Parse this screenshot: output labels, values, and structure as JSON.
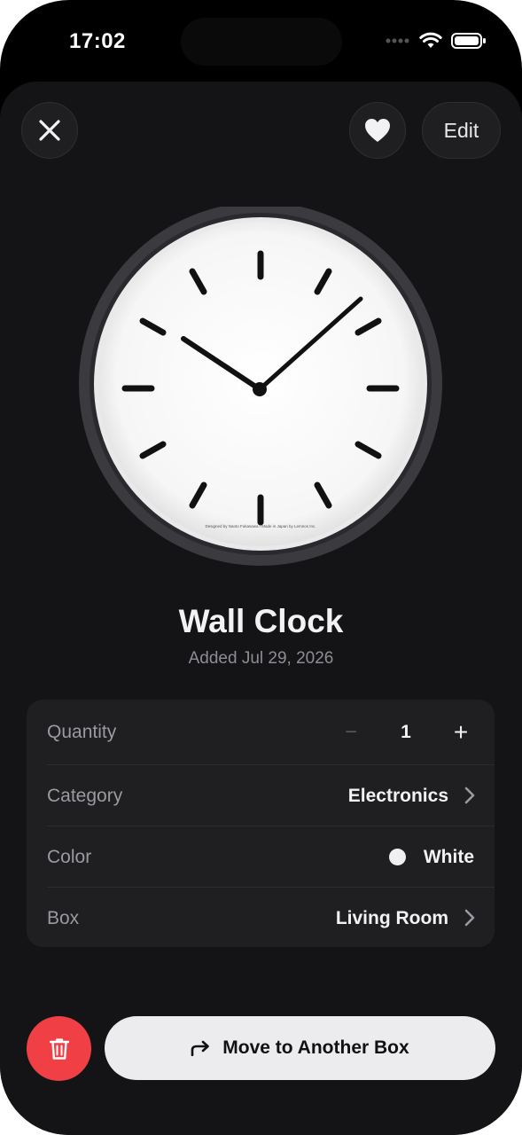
{
  "status_bar": {
    "time": "17:02"
  },
  "toolbar": {
    "close_icon": "close-icon",
    "favorite_icon": "heart-icon",
    "edit_label": "Edit"
  },
  "item": {
    "name": "Wall Clock",
    "added": "Added Jul 29, 2026",
    "clock_face_text": "Designed by Naoto Fukasawa / Made in Japan by Lemnos Inc."
  },
  "details": {
    "quantity": {
      "label": "Quantity",
      "minus": "−",
      "value": "1",
      "plus": "+"
    },
    "category": {
      "label": "Category",
      "value": "Electronics"
    },
    "color": {
      "label": "Color",
      "value": "White",
      "swatch": "#f0f0f0"
    },
    "box": {
      "label": "Box",
      "value": "Living Room"
    }
  },
  "actions": {
    "delete_icon": "trash-icon",
    "move_icon": "arrow-turn-right-icon",
    "move_label": "Move to Another Box"
  },
  "colors": {
    "background": "#141416",
    "card": "#1f1f22",
    "delete": "#f04045",
    "primary_button": "#ececee"
  }
}
